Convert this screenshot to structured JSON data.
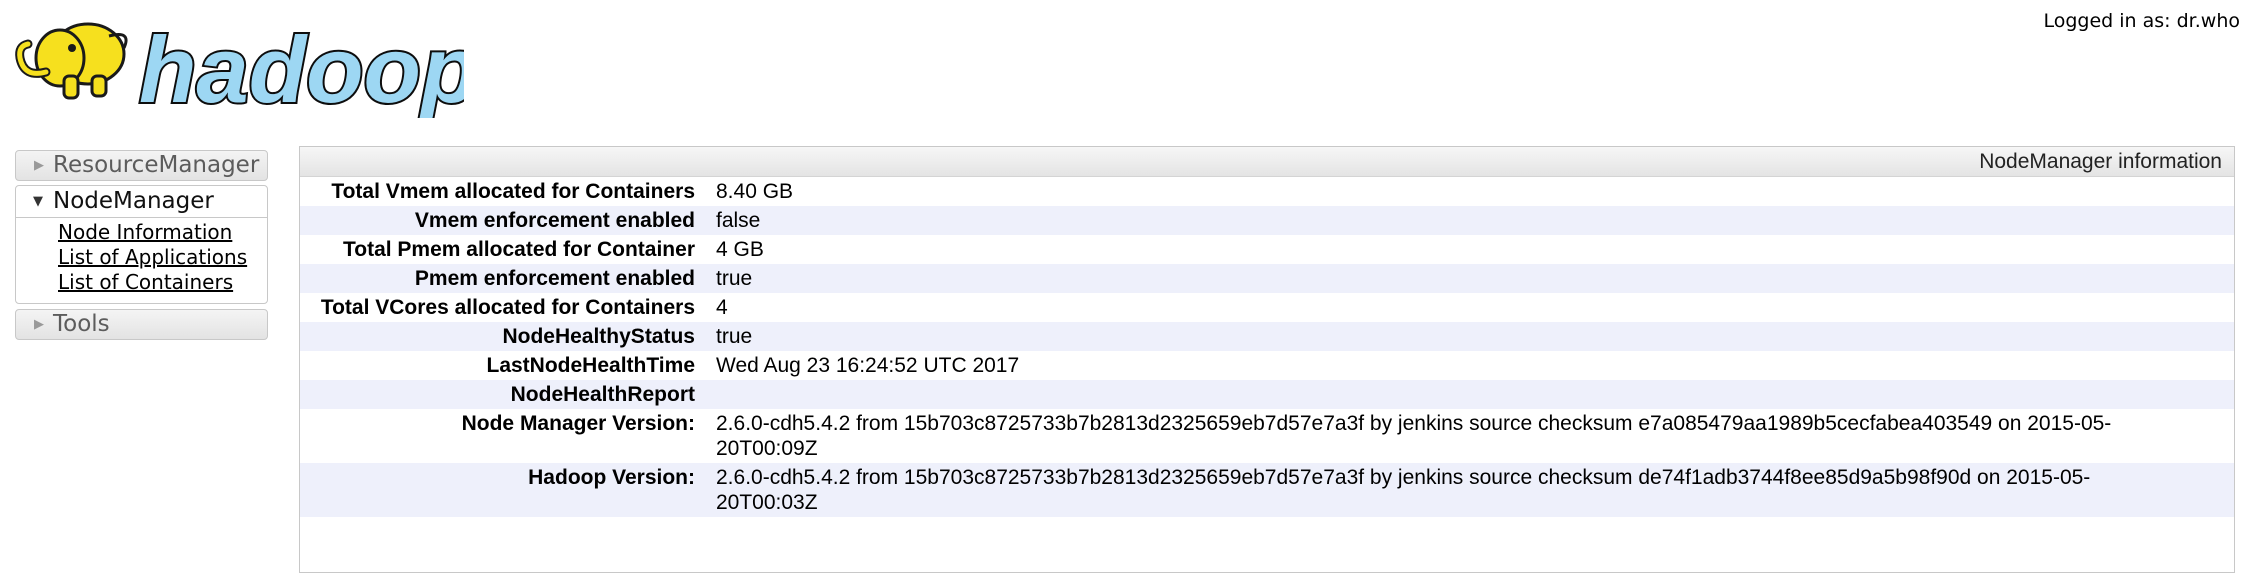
{
  "header": {
    "logo_text": "hadoop",
    "login_text": "Logged in as: dr.who"
  },
  "sidebar": {
    "sections": [
      {
        "label": "ResourceManager",
        "expanded": false,
        "icon": "triangle-right-icon"
      },
      {
        "label": "NodeManager",
        "expanded": true,
        "icon": "triangle-down-icon",
        "links": [
          "Node Information",
          "List of Applications",
          "List of Containers"
        ]
      },
      {
        "label": "Tools",
        "expanded": false,
        "icon": "triangle-right-icon"
      }
    ]
  },
  "main": {
    "title": "NodeManager information",
    "rows": [
      {
        "label": "Total Vmem allocated for Containers",
        "value": "8.40 GB"
      },
      {
        "label": "Vmem enforcement enabled",
        "value": "false"
      },
      {
        "label": "Total Pmem allocated for Container",
        "value": "4 GB"
      },
      {
        "label": "Pmem enforcement enabled",
        "value": "true"
      },
      {
        "label": "Total VCores allocated for Containers",
        "value": "4"
      },
      {
        "label": "NodeHealthyStatus",
        "value": "true"
      },
      {
        "label": "LastNodeHealthTime",
        "value": "Wed Aug 23 16:24:52 UTC 2017"
      },
      {
        "label": "NodeHealthReport",
        "value": ""
      },
      {
        "label": "Node Manager Version:",
        "value": "2.6.0-cdh5.4.2 from 15b703c8725733b7b2813d2325659eb7d57e7a3f by jenkins source checksum e7a085479aa1989b5cecfabea403549 on 2015-05-20T00:09Z"
      },
      {
        "label": "Hadoop Version:",
        "value": "2.6.0-cdh5.4.2 from 15b703c8725733b7b2813d2325659eb7d57e7a3f by jenkins source checksum de74f1adb3744f8ee85d9a5b98f90d on 2015-05-20T00:03Z"
      }
    ]
  },
  "colors": {
    "logo_fill": "#9dd7f3",
    "elephant": "#f6e01e",
    "row_alt": "#eef0fb",
    "border": "#c8c8c8"
  }
}
